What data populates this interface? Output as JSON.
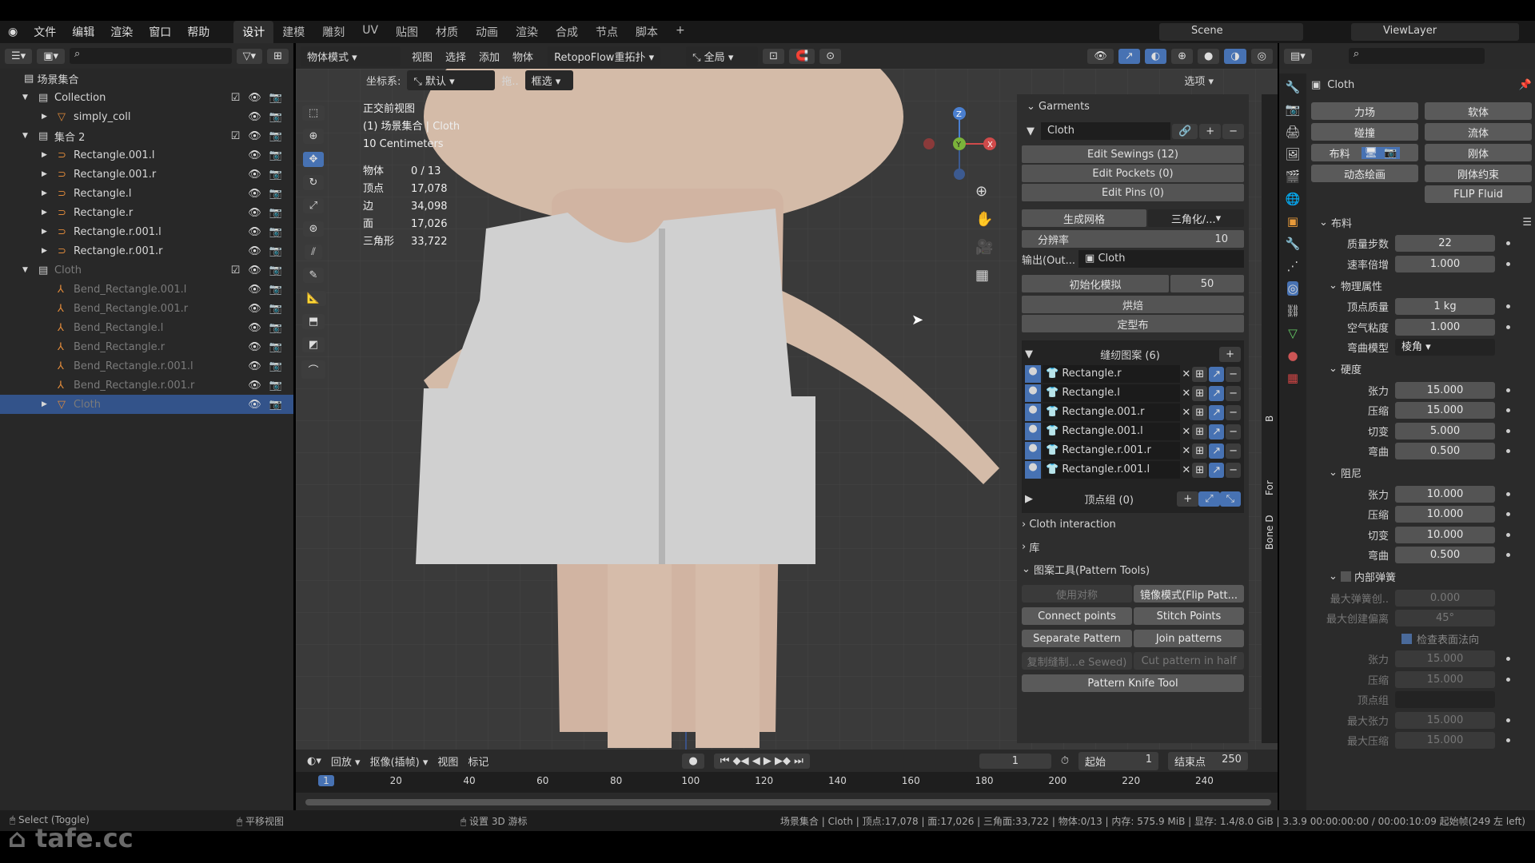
{
  "menu": [
    "文件",
    "编辑",
    "渲染",
    "窗口",
    "帮助"
  ],
  "workspaces": [
    "设计",
    "建模",
    "雕刻",
    "UV",
    "贴图",
    "材质",
    "动画",
    "渲染",
    "合成",
    "节点",
    "脚本",
    "+"
  ],
  "scene": "Scene",
  "view_layer": "ViewLayer",
  "outliner": {
    "root": "场景集合",
    "rows": [
      {
        "name": "Collection",
        "kind": "collection",
        "indent": 1,
        "check": true
      },
      {
        "name": "simply_coll",
        "kind": "mesh",
        "indent": 2,
        "check": false
      },
      {
        "name": "集合 2",
        "kind": "collection",
        "indent": 1,
        "check": true
      },
      {
        "name": "Rectangle.001.l",
        "kind": "curve",
        "indent": 2
      },
      {
        "name": "Rectangle.001.r",
        "kind": "curve",
        "indent": 2
      },
      {
        "name": "Rectangle.l",
        "kind": "curve",
        "indent": 2
      },
      {
        "name": "Rectangle.r",
        "kind": "curve",
        "indent": 2
      },
      {
        "name": "Rectangle.r.001.l",
        "kind": "curve",
        "indent": 2
      },
      {
        "name": "Rectangle.r.001.r",
        "kind": "curve",
        "indent": 2
      },
      {
        "name": "Cloth",
        "kind": "collection",
        "indent": 1,
        "check": true,
        "dim": true
      },
      {
        "name": "Bend_Rectangle.001.l",
        "kind": "armature",
        "indent": 2,
        "dim": true
      },
      {
        "name": "Bend_Rectangle.001.r",
        "kind": "armature",
        "indent": 2,
        "dim": true
      },
      {
        "name": "Bend_Rectangle.l",
        "kind": "armature",
        "indent": 2,
        "dim": true
      },
      {
        "name": "Bend_Rectangle.r",
        "kind": "armature",
        "indent": 2,
        "dim": true
      },
      {
        "name": "Bend_Rectangle.r.001.l",
        "kind": "armature",
        "indent": 2,
        "dim": true
      },
      {
        "name": "Bend_Rectangle.r.001.r",
        "kind": "armature",
        "indent": 2,
        "dim": true
      },
      {
        "name": "Cloth",
        "kind": "mesh",
        "indent": 2,
        "dim": true,
        "selected": true
      }
    ]
  },
  "viewport": {
    "mode": "物体模式",
    "menus": [
      "视图",
      "选择",
      "添加",
      "物体"
    ],
    "addon": "RetopoFlow重拓扑",
    "transform": "全局",
    "coord_label": "坐标系:",
    "coord_value": "默认",
    "drag_label": "拖..",
    "select_mode": "框选",
    "options": "选项",
    "overlay": {
      "view": "正交前视图",
      "collection": "(1) 场景集合 | Cloth",
      "scale": "10 Centimeters",
      "stats": [
        [
          "物体",
          "0 / 13"
        ],
        [
          "顶点",
          "17,078"
        ],
        [
          "边",
          "34,098"
        ],
        [
          "面",
          "17,026"
        ],
        [
          "三角形",
          "33,722"
        ]
      ]
    },
    "gizmo": {
      "z": "Z",
      "y": "Y",
      "x": "X"
    }
  },
  "npanel": {
    "garments": "Garments",
    "cloth": "Cloth",
    "edit_sewings": "Edit Sewings (12)",
    "edit_pockets": "Edit Pockets (0)",
    "edit_pins": "Edit Pins (0)",
    "gen_mesh": "生成网格",
    "triangulate": "三角化/...",
    "resolution_label": "分辨率",
    "resolution": "10",
    "output_label": "输出(Out...",
    "output_value": "Cloth",
    "init_sim": "初始化模拟",
    "init_frames": "50",
    "bake": "烘焙",
    "shape": "定型布",
    "patterns_title": "缝纫图案 (6)",
    "patterns": [
      "Rectangle.r",
      "Rectangle.l",
      "Rectangle.001.r",
      "Rectangle.001.l",
      "Rectangle.r.001.r",
      "Rectangle.r.001.l"
    ],
    "vgroups": "顶点组 (0)",
    "cloth_interaction": "Cloth interaction",
    "library": "库",
    "pattern_tools": "图案工具(Pattern Tools)",
    "use_sym": "使用对称",
    "flip": "镜像模式(Flip Patt...",
    "connect": "Connect points",
    "stitch": "Stitch Points",
    "separate": "Separate Pattern",
    "join": "Join patterns",
    "copy_sewed": "复制缝制...e Sewed)",
    "cut_half": "Cut pattern in half",
    "knife": "Pattern Knife Tool",
    "tabs": [
      "Bone D",
      "For",
      "B"
    ]
  },
  "properties": {
    "object": "Cloth",
    "physics": [
      [
        "力场",
        "软体"
      ],
      [
        "碰撞",
        "流体"
      ],
      [
        "布料",
        "刚体"
      ],
      [
        "动态绘画",
        "刚体约束"
      ],
      [
        "",
        "FLIP Fluid"
      ]
    ],
    "cloth_section": "布料",
    "quality": [
      [
        "质量步数",
        "22"
      ],
      [
        "速率倍增",
        "1.000"
      ]
    ],
    "phys_section": "物理属性",
    "phys": [
      [
        "顶点质量",
        "1 kg"
      ],
      [
        "空气粘度",
        "1.000"
      ]
    ],
    "bend_model_label": "弯曲模型",
    "bend_model": "棱角",
    "stiff_section": "硬度",
    "stiff": [
      [
        "张力",
        "15.000"
      ],
      [
        "压缩",
        "15.000"
      ],
      [
        "切变",
        "5.000"
      ],
      [
        "弯曲",
        "0.500"
      ]
    ],
    "damp_section": "阻尼",
    "damp": [
      [
        "张力",
        "10.000"
      ],
      [
        "压缩",
        "10.000"
      ],
      [
        "切变",
        "10.000"
      ],
      [
        "弯曲",
        "0.500"
      ]
    ],
    "springs_section": "内部弹簧",
    "springs_a": [
      [
        "最大弹簧创..",
        "0.000"
      ],
      [
        "最大创建偏离",
        "45°"
      ]
    ],
    "normal_check": "检查表面法向",
    "springs_b": [
      [
        "张力",
        "15.000"
      ],
      [
        "压缩",
        "15.000"
      ]
    ],
    "vgroup_label": "顶点组",
    "springs_c": [
      [
        "最大张力",
        "15.000"
      ],
      [
        "最大压缩",
        "15.000"
      ]
    ]
  },
  "timeline": {
    "playback": "回放",
    "keying": "抠像(插帧)",
    "view": "视图",
    "marker": "标记",
    "current": "1",
    "start_label": "起始",
    "start": "1",
    "end_label": "结束点",
    "end": "250",
    "ticks": [
      "1",
      "20",
      "40",
      "60",
      "80",
      "100",
      "120",
      "140",
      "160",
      "180",
      "200",
      "220",
      "240"
    ]
  },
  "status": {
    "left": "Select (Toggle)",
    "mid": "平移视图",
    "right": "设置 3D 游标",
    "info": "场景集合 | Cloth | 顶点:17,078 | 面:17,026 | 三角面:33,722 | 物体:0/13 | 内存: 575.9 MiB | 显存: 1.4/8.0 GiB | 3.3.9  00:00:00:00 / 00:00:10:09  起始帧(249 左 left)"
  },
  "watermark": "tafe.cc",
  "colors": {
    "accent": "#4772b3",
    "selection": "#33538a",
    "skin": "#d8bfae",
    "vest": "#d2d2d2"
  }
}
